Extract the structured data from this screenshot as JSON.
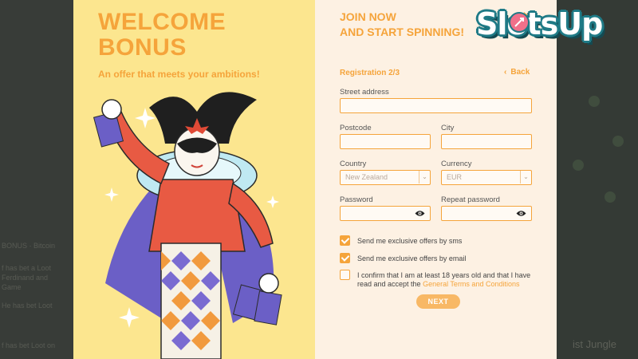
{
  "background_page": {
    "texts": [
      "BONUS · Bitcoin",
      "f has bet a Loot",
      "Ferdinand and",
      "Game",
      "He has bet Loot",
      "f has bet Loot on",
      "ist Jungle"
    ]
  },
  "promo": {
    "title_line1": "WELCOME",
    "title_line2": "BONUS",
    "subtitle": "An offer that meets your ambitions!",
    "illustration": "harlequin-jester-illustration"
  },
  "form": {
    "heading_line1": "JOIN NOW",
    "heading_line2": "AND START SPINNING!",
    "step": "Registration 2/3",
    "back_label": "Back",
    "fields": {
      "street_label": "Street address",
      "street_value": "",
      "postcode_label": "Postcode",
      "postcode_value": "",
      "city_label": "City",
      "city_value": "",
      "country_label": "Country",
      "country_value": "New Zealand",
      "currency_label": "Currency",
      "currency_value": "EUR",
      "password_label": "Password",
      "repeat_password_label": "Repeat password"
    },
    "checkboxes": {
      "sms_label": "Send me exclusive offers by sms",
      "sms_checked": true,
      "email_label": "Send me exclusive offers by email",
      "email_checked": true,
      "confirm_text": "I confirm that I am at least 18 years old and that I have read and accept the",
      "terms_link": "General Terms and Conditions",
      "confirm_checked": false
    },
    "next_label": "NEXT"
  },
  "logo": {
    "text": "SlotsUp",
    "icon": "rocket-icon"
  },
  "colors": {
    "accent": "#f5a43b",
    "promo_bg": "#fce68f",
    "form_bg": "#fdf1e3",
    "logo_outline": "#1f7a86"
  }
}
